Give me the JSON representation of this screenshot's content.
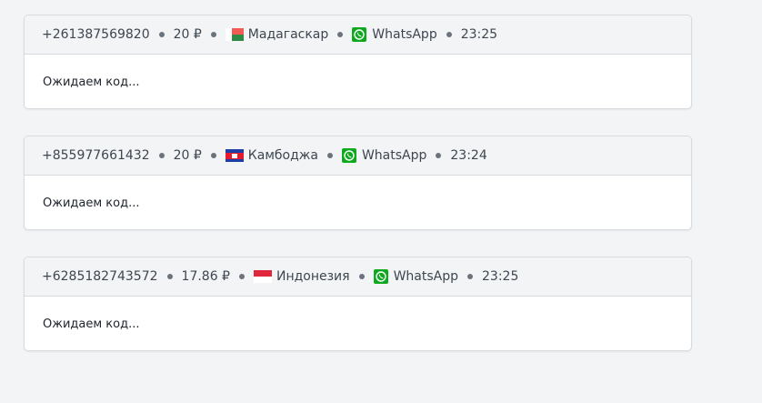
{
  "orders": [
    {
      "phone": "+261387569820",
      "price": "20 ₽",
      "country": "Мадагаскар",
      "country_flag": "madagascar-flag-icon",
      "service": "WhatsApp",
      "service_icon": "whatsapp-icon",
      "time": "23:25",
      "status": "Ожидаем код..."
    },
    {
      "phone": "+855977661432",
      "price": "20 ₽",
      "country": "Камбоджа",
      "country_flag": "cambodia-flag-icon",
      "service": "WhatsApp",
      "service_icon": "whatsapp-icon",
      "time": "23:24",
      "status": "Ожидаем код..."
    },
    {
      "phone": "+6285182743572",
      "price": "17.86 ₽",
      "country": "Индонезия",
      "country_flag": "indonesia-flag-icon",
      "service": "WhatsApp",
      "service_icon": "whatsapp-icon",
      "time": "23:25",
      "status": "Ожидаем код..."
    }
  ],
  "colors": {
    "background": "#f3f4f6",
    "card": "#ffffff",
    "whatsapp": "#0fa91f"
  }
}
